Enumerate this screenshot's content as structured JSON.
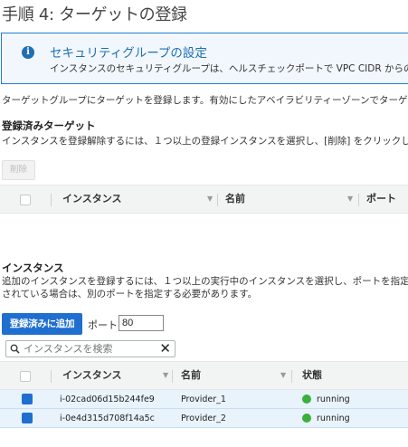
{
  "step_title": "手順 4: ターゲットの登録",
  "info": {
    "icon": "info-icon",
    "title": "セキュリティグループの設定",
    "text": "インスタンスのセキュリティグループは、ヘルスチェックポートで VPC CIDR からの"
  },
  "intro": "ターゲットグループにターゲットを登録します。有効にしたアベイラビリティーゾーンでターゲ",
  "registered": {
    "heading": "登録済みターゲット",
    "description": "インスタンスを登録解除するには、１つ以上の登録インスタンスを選択し、[削除] をクリックしま",
    "remove_button": "削除",
    "columns": [
      "インスタンス",
      "名前",
      "ポート"
    ]
  },
  "instances": {
    "heading": "インスタンス",
    "description_line1": "追加のインスタンスを登録するには、１つ以上の実行中のインスタンスを選択し、ポートを指定",
    "description_line2": "されている場合は、別のポートを指定する必要があります。",
    "add_button": "登録済みに追加",
    "port_label": "ポート",
    "port_value": "80",
    "search_placeholder": "インスタンスを検索",
    "columns": [
      "インスタンス",
      "名前",
      "状態"
    ],
    "rows": [
      {
        "id": "i-02cad06d15b244fe9",
        "name": "Provider_1",
        "state": "running",
        "checked": true
      },
      {
        "id": "i-0e4d315d708f14a5c",
        "name": "Provider_2",
        "state": "running",
        "checked": true
      }
    ]
  },
  "colors": {
    "accent": "#1f6fd0",
    "info_border": "#1f7fcf",
    "running": "#3bb03b",
    "selected_row": "#e9f3fb"
  }
}
